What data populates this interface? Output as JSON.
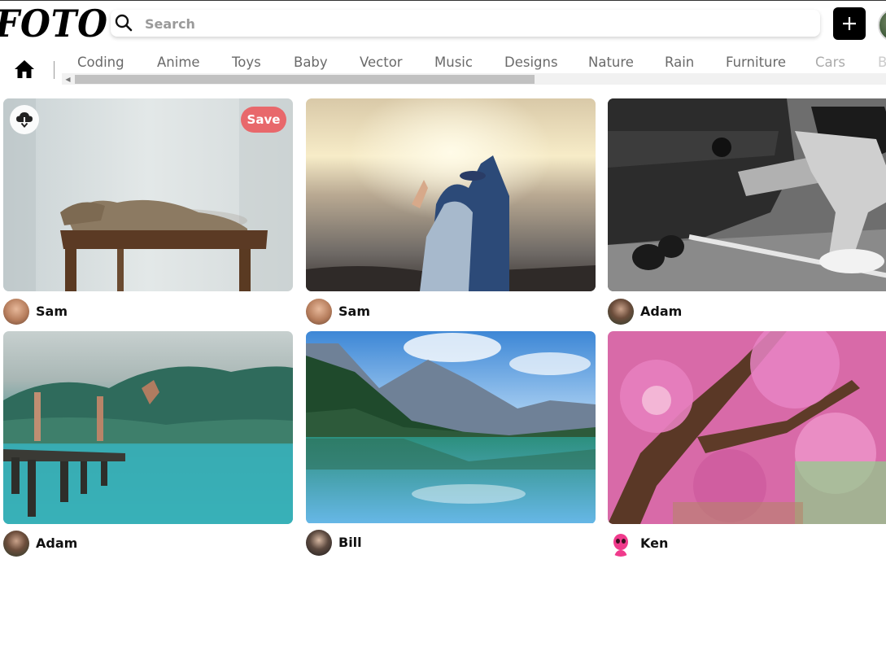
{
  "header": {
    "logo": "FOTO",
    "search_placeholder": "Search",
    "add_label": "+"
  },
  "categories": [
    "Coding",
    "Anime",
    "Toys",
    "Baby",
    "Vector",
    "Music",
    "Designs",
    "Nature",
    "Rain",
    "Furniture",
    "Cars",
    "B"
  ],
  "cards": [
    {
      "author": "Sam",
      "image": "cat on wooden stool",
      "save_label": "Save"
    },
    {
      "author": "Sam",
      "image": "graduates hugging at sunset by the sea"
    },
    {
      "author": "Adam",
      "image": "man attaching hitch to car"
    },
    {
      "author": "Adam",
      "image": "people jumping from pier into turquoise water"
    },
    {
      "author": "Bill",
      "image": "mountain lake reflection"
    },
    {
      "author": "Ken",
      "image": "pink cherry blossoms"
    }
  ],
  "colors": {
    "save_button": "#e8686b",
    "add_button": "#000000",
    "category_text": "#6a6a6a"
  }
}
